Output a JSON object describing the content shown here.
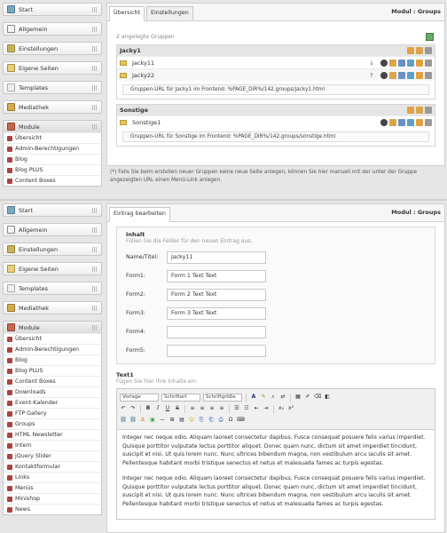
{
  "nav": {
    "start": "Start",
    "allgemein": "Allgemein",
    "einstellungen": "Einstellungen",
    "eigene_seiten": "Eigene Seiten",
    "templates": "Templates",
    "mediathek": "Mediathek",
    "module": "Module"
  },
  "modules_top": [
    "Übersicht",
    "Admin-Berechtigungen",
    "Blog",
    "Blog PLUS",
    "Content Boxes"
  ],
  "modules_bottom": [
    "Übersicht",
    "Admin-Berechtigungen",
    "Blog",
    "Blog PLUS",
    "Content Boxes",
    "Downloads",
    "Event-Kalender",
    "FTP Gallery",
    "Groups",
    "HTML Newsletter",
    "Intern",
    "jQuery Slider",
    "Kontaktformular",
    "Links",
    "Menüs",
    "Minishop",
    "News"
  ],
  "top": {
    "tabs": [
      "Übersicht",
      "Einstellungen"
    ],
    "module_label": "Modul : Groups",
    "count": "2 angelegte Gruppen",
    "groups": [
      {
        "name": "Jacky1",
        "rows": [
          {
            "name": "Jacky11",
            "arrow": "↓"
          },
          {
            "name": "Jacky22",
            "arrow": "↑"
          }
        ],
        "url": "Gruppen-URL für Jacky1 im Frontend: %PAGE_DIR%/142.groups/jacky1.html"
      },
      {
        "name": "Sonstige",
        "rows": [
          {
            "name": "Sonstige1",
            "arrow": ""
          }
        ],
        "url": "Gruppen-URL für Sonstige im Frontend: %PAGE_DIR%/142.groups/sonstige.html"
      }
    ],
    "note": "(*) Falls Sie beim erstellen neuer Gruppen keine neue Seite anlegen, können Sie hier manuell mit der unter der Gruppe angezeigten URL einen Menü-Link anlegen."
  },
  "bottom": {
    "tab": "Eintrag bearbeiten",
    "module_label": "Modul : Groups",
    "inhalt_title": "Inhalt",
    "inhalt_hint": "Füllen Sie die Felder für den neuen Eintrag aus:",
    "fields": [
      {
        "label": "Name/Titel:",
        "value": "Jacky11"
      },
      {
        "label": "Form1:",
        "value": "Form 1 Text Text"
      },
      {
        "label": "Form2:",
        "value": "Form 2 Text Text"
      },
      {
        "label": "Form3:",
        "value": "Form 3 Text Text"
      },
      {
        "label": "Form4:",
        "value": ""
      },
      {
        "label": "Form5:",
        "value": ""
      }
    ],
    "text_title": "Text1",
    "text_hint": "Fügen Sie hier Ihre Inhalte ein:",
    "toolbar": {
      "style": "Vorlage",
      "font": "Schriftart",
      "size": "Schriftgröße"
    },
    "paragraphs": [
      "Integer nec neque odio. Aliquam laoreet consectetur dapibus. Fusce consequat posuere felis varius imperdiet. Quisque porttitor vulputate lectus porttitor aliquet. Donec quam nunc, dictum sit amet imperdiet tincidunt, suscipit et nisi. Ut quis lorem nunc. Nunc ultrices bibendum magna, non vestibulum arcu iaculis sit amet. Pellentesque habitant morbi tristique senectus et netus et malesuada fames ac turpis egestas.",
      "Integer nec neque odio. Aliquam laoreet consectetur dapibus. Fusce consequat posuere felis varius imperdiet. Quisque porttitor vulputate lectus porttitor aliquet. Donec quam nunc, dictum sit amet imperdiet tincidunt, suscipit et nisi. Ut quis lorem nunc. Nunc ultrices bibendum magna, non vestibulum arcu iaculis sit amet. Pellentesque habitant morbi tristique senectus et netus et malesuada fames ac turpis egestas."
    ]
  }
}
